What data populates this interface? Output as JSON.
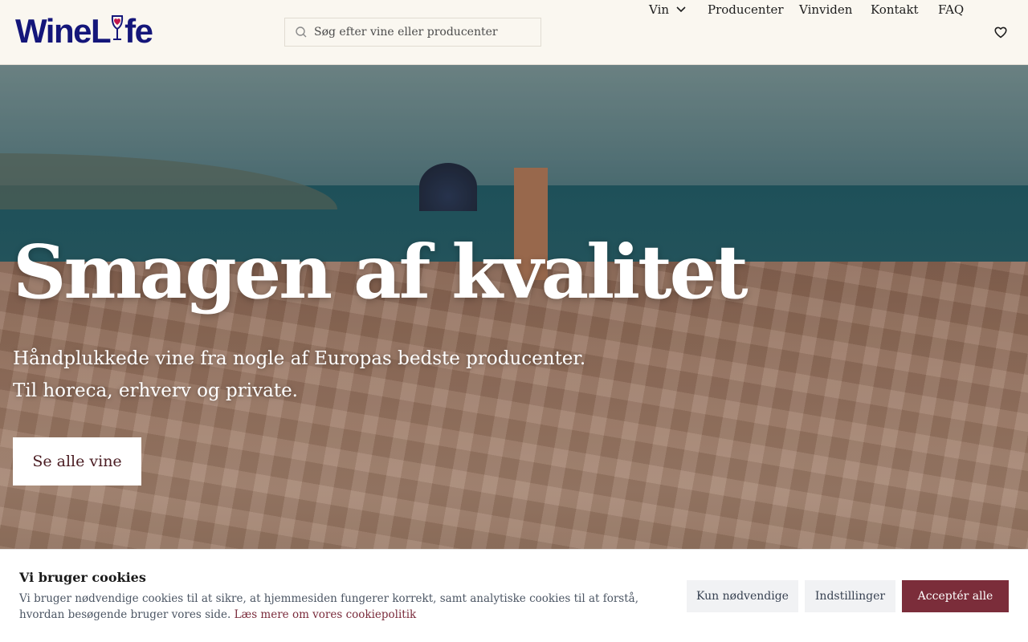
{
  "header": {
    "logo_text_1": "WineL",
    "logo_text_2": "fe",
    "search_placeholder": "Søg efter vine eller producenter",
    "nav": [
      {
        "label": "Vin",
        "has_dropdown": true
      },
      {
        "label": "Producenter"
      },
      {
        "label": "Vinviden"
      },
      {
        "label": "Kontakt"
      },
      {
        "label": "FAQ"
      }
    ],
    "icons": {
      "search": "search-icon",
      "dropdown": "chevron-down-icon",
      "favorites": "heart-icon"
    }
  },
  "hero": {
    "title": "Smagen af kvalitet",
    "subtitle_line1": "Håndplukkede vine fra nogle af Europas bedste producenter.",
    "subtitle_line2": "Til horeca, erhverv og private.",
    "cta_label": "Se alle vine"
  },
  "cookie": {
    "title": "Vi bruger cookies",
    "text": "Vi bruger nødvendige cookies til at sikre, at hjemmesiden fungerer korrekt, samt analytiske cookies til at forstå, hvordan besøgende bruger vores side.",
    "link_label": "Læs mere om vores cookiepolitik",
    "buttons": {
      "necessary": "Kun nødvendige",
      "settings": "Indstillinger",
      "accept_all": "Acceptér alle"
    }
  },
  "colors": {
    "brand_navy": "#14167a",
    "brand_wine": "#7b2d3a",
    "header_bg": "#faf7f0"
  }
}
